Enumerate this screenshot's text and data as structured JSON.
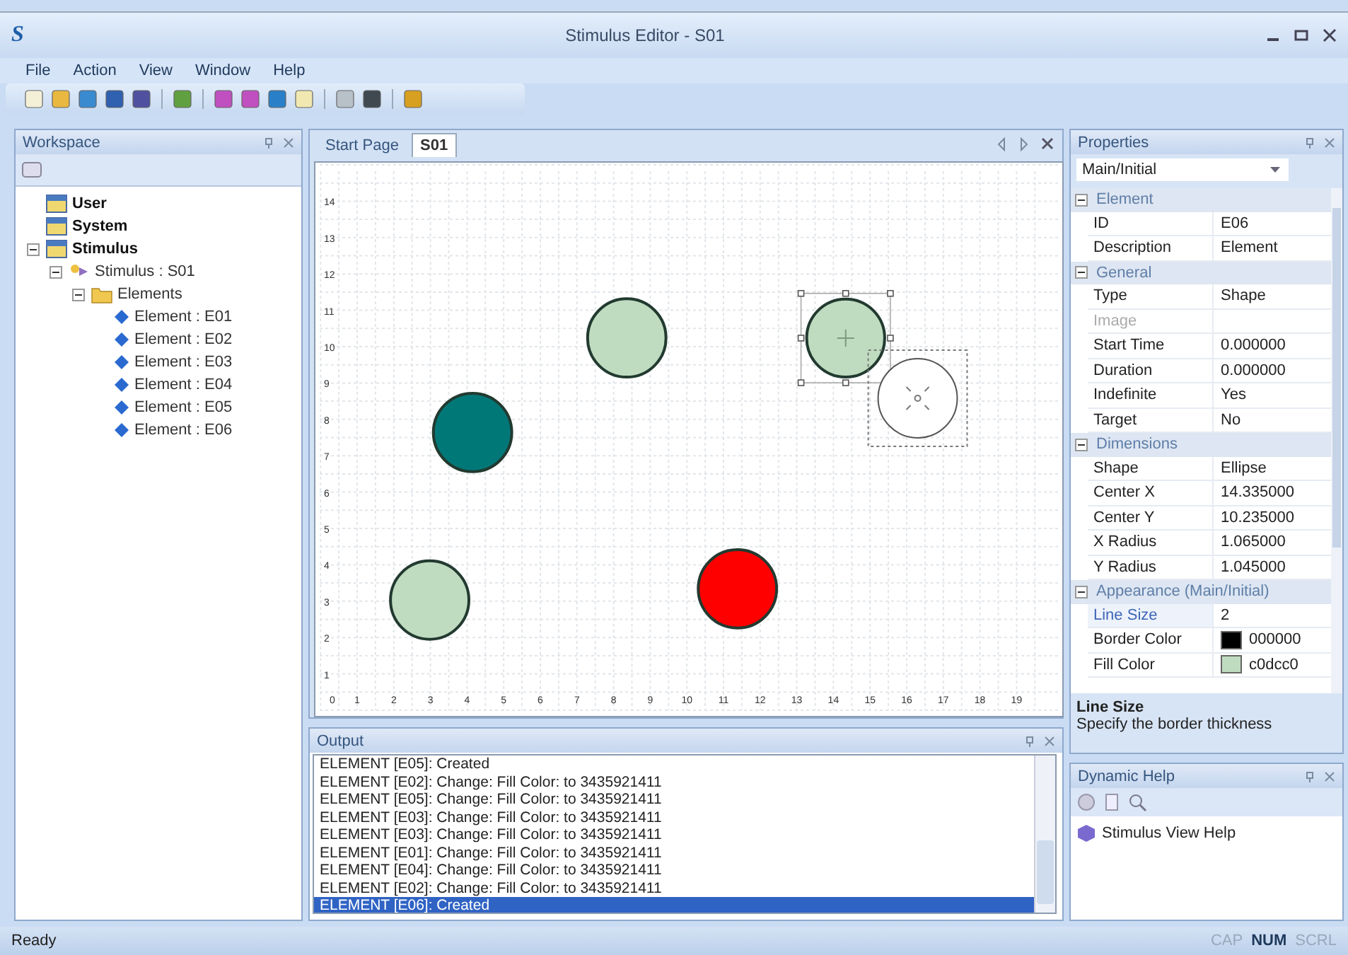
{
  "window": {
    "logo": "S",
    "title": "Stimulus Editor - S01"
  },
  "menu": [
    "File",
    "Action",
    "View",
    "Window",
    "Help"
  ],
  "workspace": {
    "title": "Workspace",
    "tree": [
      {
        "label": "User",
        "kind": "database"
      },
      {
        "label": "System",
        "kind": "database"
      },
      {
        "label": "Stimulus",
        "kind": "database",
        "expanded": true,
        "children": [
          {
            "label": "Stimulus : S01",
            "kind": "stimulus",
            "expanded": true,
            "children": [
              {
                "label": "Elements",
                "kind": "folder",
                "expanded": true,
                "children": [
                  {
                    "label": "Element : E01",
                    "kind": "element"
                  },
                  {
                    "label": "Element : E02",
                    "kind": "element"
                  },
                  {
                    "label": "Element : E03",
                    "kind": "element"
                  },
                  {
                    "label": "Element : E04",
                    "kind": "element"
                  },
                  {
                    "label": "Element : E05",
                    "kind": "element"
                  },
                  {
                    "label": "Element : E06",
                    "kind": "element"
                  }
                ]
              }
            ]
          }
        ]
      }
    ]
  },
  "tabs": [
    {
      "label": "Start Page",
      "selected": false
    },
    {
      "label": "S01",
      "selected": true
    }
  ],
  "canvas": {
    "origin_label": "0",
    "x_labels": [
      "1",
      "2",
      "3",
      "4",
      "5",
      "6",
      "7",
      "8",
      "9",
      "10",
      "11",
      "12",
      "13",
      "14",
      "15",
      "16",
      "17",
      "18",
      "19"
    ],
    "y_labels": [
      "14",
      "13",
      "12",
      "11",
      "10",
      "9",
      "8",
      "7",
      "6",
      "5",
      "4",
      "3",
      "2",
      "1"
    ],
    "shapes": [
      {
        "kind": "ellipse",
        "color": "#c0dcc0",
        "selected": false
      },
      {
        "kind": "ellipse",
        "color": "#c0dcc0",
        "selected": true
      },
      {
        "kind": "drag-preview"
      },
      {
        "kind": "ellipse",
        "color": "#007878",
        "selected": false
      },
      {
        "kind": "ellipse",
        "color": "#c0dcc0",
        "selected": false
      },
      {
        "kind": "ellipse",
        "color": "#ff0000",
        "selected": false
      }
    ]
  },
  "output": {
    "title": "Output",
    "lines": [
      {
        "text": "ELEMENT [E05]: Created",
        "selected": false
      },
      {
        "text": "ELEMENT [E02]: Change: Fill Color: to 3435921411",
        "selected": false
      },
      {
        "text": "ELEMENT [E05]: Change: Fill Color: to 3435921411",
        "selected": false
      },
      {
        "text": "ELEMENT [E03]: Change: Fill Color: to 3435921411",
        "selected": false
      },
      {
        "text": "ELEMENT [E03]: Change: Fill Color: to 3435921411",
        "selected": false
      },
      {
        "text": "ELEMENT [E01]: Change: Fill Color: to 3435921411",
        "selected": false
      },
      {
        "text": "ELEMENT [E04]: Change: Fill Color: to 3435921411",
        "selected": false
      },
      {
        "text": "ELEMENT [E02]: Change: Fill Color: to 3435921411",
        "selected": false
      },
      {
        "text": "ELEMENT [E06]: Created",
        "selected": true
      }
    ]
  },
  "properties": {
    "title": "Properties",
    "selector": "Main/Initial",
    "categories": [
      {
        "label": "Element",
        "expanded": true,
        "rows": [
          {
            "name": "ID",
            "value": "E06",
            "selected": false,
            "disabled": false
          },
          {
            "name": "Description",
            "value": "Element",
            "selected": false,
            "disabled": false
          }
        ]
      },
      {
        "label": "General",
        "expanded": true,
        "rows": [
          {
            "name": "Type",
            "value": "Shape",
            "selected": false,
            "disabled": false
          },
          {
            "name": "Image",
            "selected": false,
            "disabled": true
          },
          {
            "name": "Start Time",
            "value": "0.000000",
            "selected": false,
            "disabled": false
          },
          {
            "name": "Duration",
            "value": "0.000000",
            "selected": false,
            "disabled": false
          },
          {
            "name": "Indefinite",
            "value": "Yes",
            "selected": false,
            "disabled": false
          },
          {
            "name": "Target",
            "value": "No",
            "selected": false,
            "disabled": false
          }
        ]
      },
      {
        "label": "Dimensions",
        "expanded": true,
        "rows": [
          {
            "name": "Shape",
            "value": "Ellipse",
            "selected": false,
            "disabled": false
          },
          {
            "name": "Center X",
            "value": "14.335000",
            "selected": false,
            "disabled": false
          },
          {
            "name": "Center Y",
            "value": "10.235000",
            "selected": false,
            "disabled": false
          },
          {
            "name": "X Radius",
            "value": "1.065000",
            "selected": false,
            "disabled": false
          },
          {
            "name": "Y Radius",
            "value": "1.045000",
            "selected": false,
            "disabled": false
          }
        ]
      },
      {
        "label": "Appearance (Main/Initial)",
        "expanded": true,
        "rows": [
          {
            "name": "Line Size",
            "value": "2",
            "selected": true,
            "disabled": false
          },
          {
            "name": "Border Color",
            "value": "000000",
            "color": "#000000",
            "selected": false,
            "disabled": false
          },
          {
            "name": "Fill Color",
            "value": "c0dcc0",
            "color": "#c0dcc0",
            "selected": false,
            "disabled": false
          }
        ]
      }
    ],
    "description_title": "Line Size",
    "description": "Specify the border thickness"
  },
  "dynamic_help": {
    "title": "Dynamic Help",
    "items": [
      "Stimulus View Help"
    ]
  },
  "status_bar": {
    "text": "Ready",
    "indicators": [
      {
        "label": "CAP",
        "on": false
      },
      {
        "label": "NUM",
        "on": true
      },
      {
        "label": "SCRL",
        "on": false
      }
    ]
  }
}
